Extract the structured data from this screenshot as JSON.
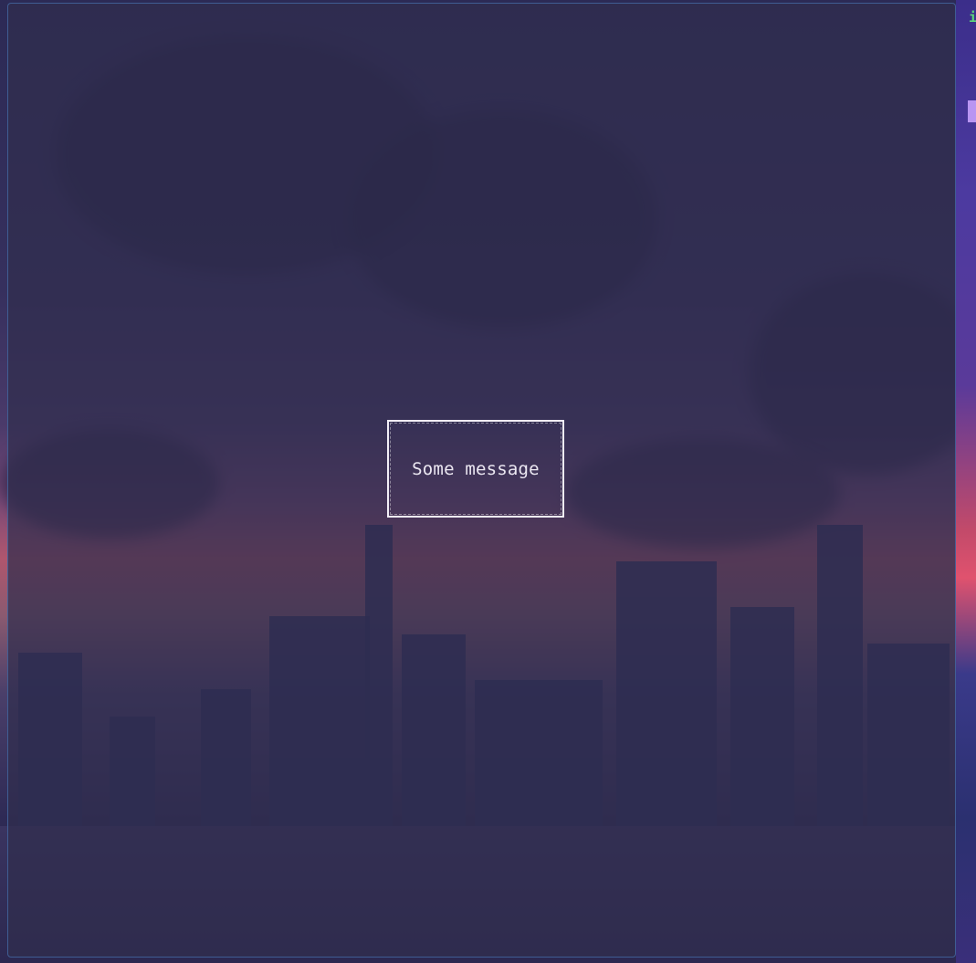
{
  "dialog": {
    "message": "Some message"
  },
  "side_panel": {
    "glyph": "i"
  },
  "colors": {
    "overlay": "#302e4e",
    "border": "#f2eef6",
    "text": "#ece8f2",
    "accent": "#b995f2",
    "glyph": "#5cd67a"
  }
}
